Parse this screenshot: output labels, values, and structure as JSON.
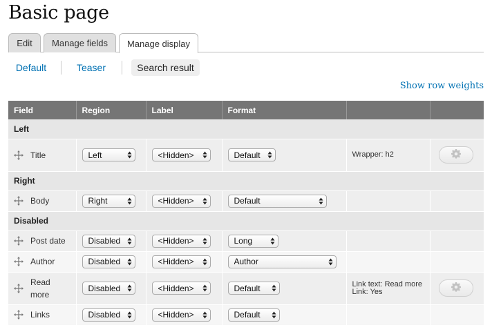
{
  "page": {
    "title": "Basic page"
  },
  "primary_tabs": [
    {
      "label": "Edit",
      "active": false
    },
    {
      "label": "Manage fields",
      "active": false
    },
    {
      "label": "Manage display",
      "active": true
    }
  ],
  "secondary_tabs": [
    {
      "label": "Default",
      "active": false
    },
    {
      "label": "Teaser",
      "active": false
    },
    {
      "label": "Search result",
      "active": true
    }
  ],
  "show_row_weights": "Show row weights",
  "table": {
    "headers": {
      "field": "Field",
      "region": "Region",
      "label": "Label",
      "format": "Format"
    },
    "regions": {
      "left": "Left",
      "right": "Right",
      "disabled": "Disabled"
    },
    "rows": [
      {
        "name": "Title",
        "region": "Left",
        "label": "<Hidden>",
        "format": "Default",
        "summary": [
          "Wrapper: h2"
        ],
        "settings": true
      },
      {
        "name": "Body",
        "region": "Right",
        "label": "<Hidden>",
        "format": "Default",
        "summary": [],
        "settings": false
      },
      {
        "name": "Post date",
        "region": "Disabled",
        "label": "<Hidden>",
        "format": "Long",
        "summary": [],
        "settings": false
      },
      {
        "name": "Author",
        "region": "Disabled",
        "label": "<Hidden>",
        "format": "Author",
        "summary": [],
        "settings": false
      },
      {
        "name": "Read more",
        "region": "Disabled",
        "label": "<Hidden>",
        "format": "Default",
        "summary": [
          "Link text: Read more",
          "Link: Yes"
        ],
        "settings": true
      },
      {
        "name": "Links",
        "region": "Disabled",
        "label": "<Hidden>",
        "format": "Default",
        "summary": [],
        "settings": false
      }
    ]
  },
  "icons": {
    "drag": "drag-handle-icon",
    "select_arrow": "select-arrows-icon",
    "settings": "gear-icon"
  },
  "colors": {
    "link": "#0071b3",
    "header_bg": "#757575"
  }
}
